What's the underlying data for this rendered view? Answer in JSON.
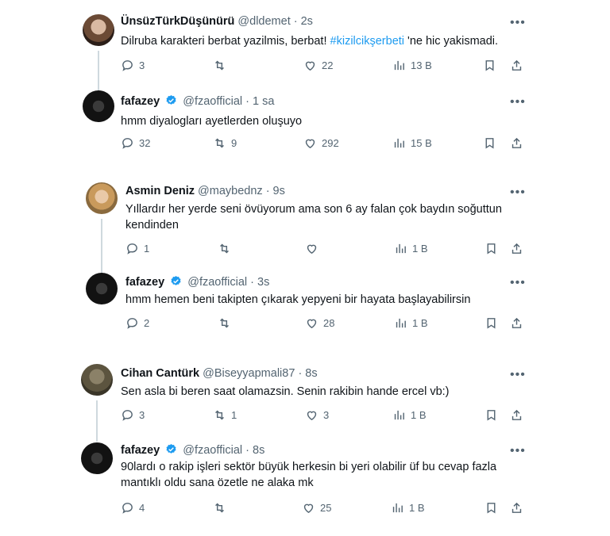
{
  "tweets": [
    {
      "name": "ÜnsüzTürkDüşünürü",
      "handle": "@dldemet",
      "time": "· 2s",
      "text_before": "Dilruba karakteri berbat yazilmis, berbat! ",
      "hashtag": "#kizilcikşerbeti",
      "text_after": " 'ne hic yakismadi.",
      "replies": "3",
      "retweets": "",
      "likes": "22",
      "views": "13 B"
    },
    {
      "name": "fafazey",
      "handle": "@fzaofficial",
      "time": "· 1 sa",
      "text": "hmm diyalogları ayetlerden oluşuyo",
      "replies": "32",
      "retweets": "9",
      "likes": "292",
      "views": "15 B"
    },
    {
      "name": "Asmin Deniz",
      "handle": "@maybednz",
      "time": "· 9s",
      "text_line1": "Yıllardır her yerde seni övüyorum ama son 6 ay falan çok baydın soğuttun",
      "text_line2": "kendinden",
      "replies": "1",
      "retweets": "",
      "likes": "",
      "views": "1 B"
    },
    {
      "name": "fafazey",
      "handle": "@fzaofficial",
      "time": "· 3s",
      "text": "hmm hemen beni takipten çıkarak yepyeni bir hayata başlayabilirsin",
      "replies": "2",
      "retweets": "",
      "likes": "28",
      "views": "1 B"
    },
    {
      "name": "Cihan Cantürk",
      "handle": "@Biseyyapmali87",
      "time": "· 8s",
      "text": "Sen asla bi beren saat olamazsin. Senin rakibin hande ercel vb:)",
      "replies": "3",
      "retweets": "1",
      "likes": "3",
      "views": "1 B"
    },
    {
      "name": "fafazey",
      "handle": "@fzaofficial",
      "time": "· 8s",
      "text_line1": "90lardı o rakip işleri sektör büyük herkesin bi yeri olabilir üf bu cevap fazla",
      "text_line2": "mantıklı oldu sana özetle ne alaka mk",
      "replies": "4",
      "retweets": "",
      "likes": "25",
      "views": "1 B"
    }
  ],
  "more_label": "•••",
  "colors": {
    "accent": "#1d9bf0",
    "muted": "#536471",
    "text": "#0f1419",
    "verified": "#1d9bf0"
  },
  "icons": [
    "reply-icon",
    "retweet-icon",
    "like-icon",
    "views-icon",
    "bookmark-icon",
    "share-icon",
    "verified-badge-icon",
    "more-icon"
  ]
}
